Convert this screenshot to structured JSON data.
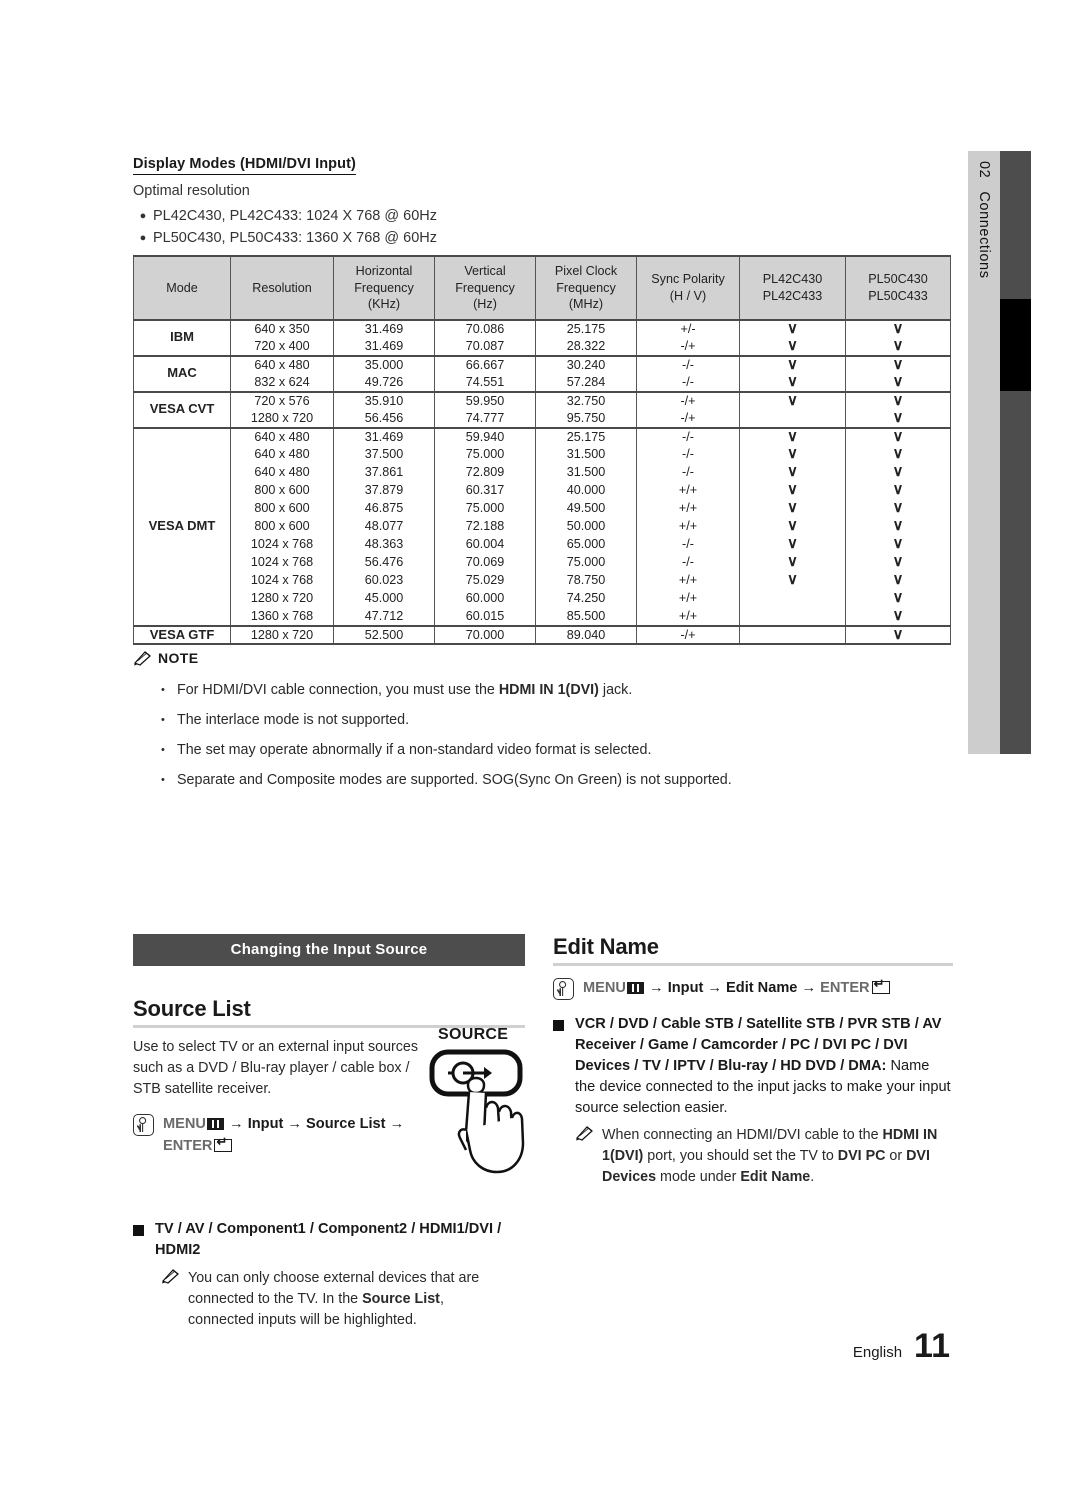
{
  "side_tab": {
    "number": "02",
    "label": "Connections"
  },
  "display_modes": {
    "heading": "Display Modes (HDMI/DVI Input)",
    "optimal_label": "Optimal resolution",
    "optimal_items": [
      "PL42C430, PL42C433: 1024 X 768 @ 60Hz",
      "PL50C430, PL50C433: 1360 X 768 @ 60Hz"
    ],
    "table": {
      "headers": [
        {
          "l1": "Mode",
          "l2": "",
          "l3": ""
        },
        {
          "l1": "Resolution",
          "l2": "",
          "l3": ""
        },
        {
          "l1": "Horizontal",
          "l2": "Frequency",
          "l3": "(KHz)"
        },
        {
          "l1": "Vertical",
          "l2": "Frequency",
          "l3": "(Hz)"
        },
        {
          "l1": "Pixel Clock",
          "l2": "Frequency",
          "l3": "(MHz)"
        },
        {
          "l1": "Sync Polarity",
          "l2": "(H / V)",
          "l3": ""
        },
        {
          "l1": "PL42C430",
          "l2": "PL42C433",
          "l3": ""
        },
        {
          "l1": "PL50C430",
          "l2": "PL50C433",
          "l3": ""
        }
      ],
      "check_glyph": "∨",
      "groups": [
        {
          "mode": "IBM",
          "rows": [
            {
              "resolution": "640 x 350",
              "h_freq": "31.469",
              "v_freq": "70.086",
              "pixel_clock": "25.175",
              "sync": "+/-",
              "pl42": true,
              "pl50": true
            },
            {
              "resolution": "720 x 400",
              "h_freq": "31.469",
              "v_freq": "70.087",
              "pixel_clock": "28.322",
              "sync": "-/+",
              "pl42": true,
              "pl50": true
            }
          ]
        },
        {
          "mode": "MAC",
          "rows": [
            {
              "resolution": "640 x 480",
              "h_freq": "35.000",
              "v_freq": "66.667",
              "pixel_clock": "30.240",
              "sync": "-/-",
              "pl42": true,
              "pl50": true
            },
            {
              "resolution": "832 x 624",
              "h_freq": "49.726",
              "v_freq": "74.551",
              "pixel_clock": "57.284",
              "sync": "-/-",
              "pl42": true,
              "pl50": true
            }
          ]
        },
        {
          "mode": "VESA CVT",
          "rows": [
            {
              "resolution": "720 x 576",
              "h_freq": "35.910",
              "v_freq": "59.950",
              "pixel_clock": "32.750",
              "sync": "-/+",
              "pl42": true,
              "pl50": true
            },
            {
              "resolution": "1280 x 720",
              "h_freq": "56.456",
              "v_freq": "74.777",
              "pixel_clock": "95.750",
              "sync": "-/+",
              "pl42": false,
              "pl50": true
            }
          ]
        },
        {
          "mode": "VESA DMT",
          "rows": [
            {
              "resolution": "640 x 480",
              "h_freq": "31.469",
              "v_freq": "59.940",
              "pixel_clock": "25.175",
              "sync": "-/-",
              "pl42": true,
              "pl50": true
            },
            {
              "resolution": "640 x 480",
              "h_freq": "37.500",
              "v_freq": "75.000",
              "pixel_clock": "31.500",
              "sync": "-/-",
              "pl42": true,
              "pl50": true
            },
            {
              "resolution": "640 x 480",
              "h_freq": "37.861",
              "v_freq": "72.809",
              "pixel_clock": "31.500",
              "sync": "-/-",
              "pl42": true,
              "pl50": true
            },
            {
              "resolution": "800 x 600",
              "h_freq": "37.879",
              "v_freq": "60.317",
              "pixel_clock": "40.000",
              "sync": "+/+",
              "pl42": true,
              "pl50": true
            },
            {
              "resolution": "800 x 600",
              "h_freq": "46.875",
              "v_freq": "75.000",
              "pixel_clock": "49.500",
              "sync": "+/+",
              "pl42": true,
              "pl50": true
            },
            {
              "resolution": "800 x 600",
              "h_freq": "48.077",
              "v_freq": "72.188",
              "pixel_clock": "50.000",
              "sync": "+/+",
              "pl42": true,
              "pl50": true
            },
            {
              "resolution": "1024 x 768",
              "h_freq": "48.363",
              "v_freq": "60.004",
              "pixel_clock": "65.000",
              "sync": "-/-",
              "pl42": true,
              "pl50": true
            },
            {
              "resolution": "1024 x 768",
              "h_freq": "56.476",
              "v_freq": "70.069",
              "pixel_clock": "75.000",
              "sync": "-/-",
              "pl42": true,
              "pl50": true
            },
            {
              "resolution": "1024 x 768",
              "h_freq": "60.023",
              "v_freq": "75.029",
              "pixel_clock": "78.750",
              "sync": "+/+",
              "pl42": true,
              "pl50": true
            },
            {
              "resolution": "1280 x 720",
              "h_freq": "45.000",
              "v_freq": "60.000",
              "pixel_clock": "74.250",
              "sync": "+/+",
              "pl42": false,
              "pl50": true
            },
            {
              "resolution": "1360 x 768",
              "h_freq": "47.712",
              "v_freq": "60.015",
              "pixel_clock": "85.500",
              "sync": "+/+",
              "pl42": false,
              "pl50": true
            }
          ]
        },
        {
          "mode": "VESA GTF",
          "rows": [
            {
              "resolution": "1280 x 720",
              "h_freq": "52.500",
              "v_freq": "70.000",
              "pixel_clock": "89.040",
              "sync": "-/+",
              "pl42": false,
              "pl50": true
            }
          ]
        }
      ]
    }
  },
  "note": {
    "title": "NOTE",
    "items": [
      {
        "pre": "For HDMI/DVI cable connection, you must use the ",
        "bold": "HDMI IN 1(DVI)",
        "post": " jack."
      },
      {
        "pre": "The interlace mode is not supported.",
        "bold": "",
        "post": ""
      },
      {
        "pre": "The set may operate abnormally if a non-standard video format is selected.",
        "bold": "",
        "post": ""
      },
      {
        "pre": "Separate and Composite modes are supported. SOG(Sync On Green) is not supported.",
        "bold": "",
        "post": ""
      }
    ]
  },
  "changing_input_source": {
    "bar_title": "Changing the Input Source",
    "source_list": {
      "heading": "Source List",
      "paragraph": "Use to select TV or an external input sources such as a DVD / Blu-ray player / cable box / STB satellite receiver.",
      "menu_path_1": "MENU",
      "menu_path_2": "→ Input → Source List →",
      "menu_path_3": "ENTER",
      "source_button_label": "SOURCE",
      "options": "TV / AV / Component1 / Component2 / HDMI1/DVI / HDMI2",
      "subnote_pre": "You can only choose external devices that are connected to the TV. In the ",
      "subnote_bold": "Source List",
      "subnote_post": ", connected inputs will be highlighted."
    }
  },
  "edit_name": {
    "heading": "Edit Name",
    "menu_path_1": "MENU",
    "menu_path_2": "→ Input → Edit Name →",
    "menu_path_3": "ENTER",
    "devices_bold": "VCR / DVD / Cable STB / Satellite STB / PVR STB / AV Receiver / Game / Camcorder / PC / DVI PC / DVI Devices / TV / IPTV / Blu-ray / HD DVD / DMA",
    "devices_colon": ":",
    "devices_desc": " Name the device connected to the input jacks to make your input source selection easier.",
    "subnote_a": "When connecting an HDMI/DVI cable to the ",
    "subnote_b1": "HDMI IN 1(DVI)",
    "subnote_b2": " port, you should set the TV to ",
    "subnote_b3": "DVI PC",
    "subnote_b4": " or ",
    "subnote_b5": "DVI Devices",
    "subnote_b6": " mode under ",
    "subnote_b7": "Edit Name",
    "subnote_b8": "."
  },
  "footer": {
    "language": "English",
    "page": "11"
  },
  "colors": {
    "table_header_bg": "#d2d2d2",
    "bar_title_bg": "#4d4d4d",
    "side_tab_bg": "#cdcdcd",
    "side_bar": "#4d4d4d",
    "side_bar_active": "#000000"
  }
}
